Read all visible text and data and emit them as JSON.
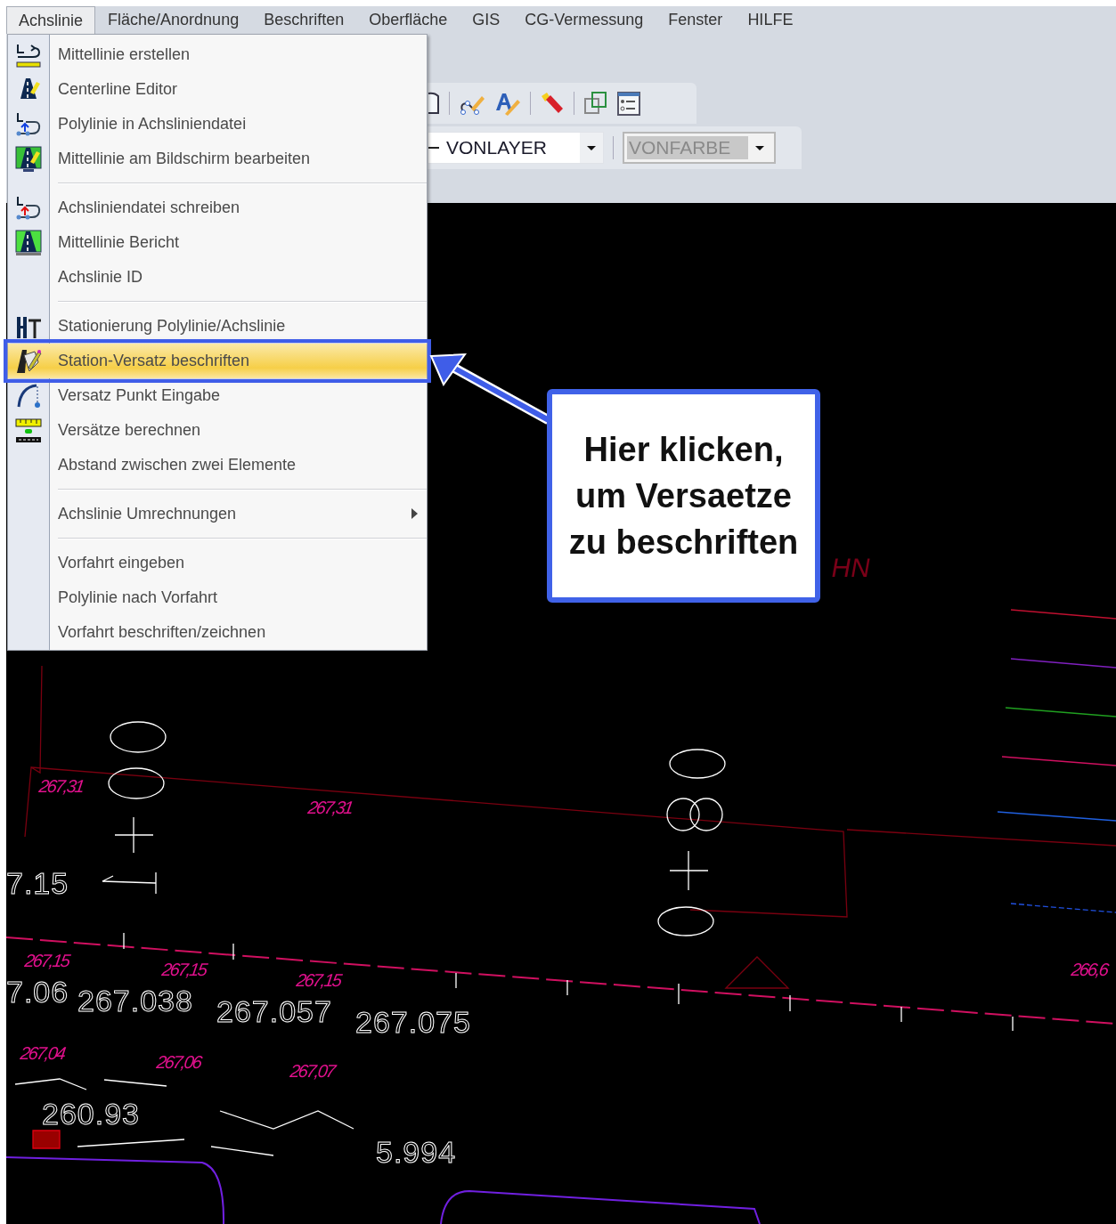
{
  "menu_bar": [
    {
      "label": "Achslinie",
      "selected": true
    },
    {
      "label": "Fläche/Anordnung",
      "selected": false
    },
    {
      "label": "Beschriften",
      "selected": false
    },
    {
      "label": "Oberfläche",
      "selected": false
    },
    {
      "label": "GIS",
      "selected": false
    },
    {
      "label": "CG-Vermessung",
      "selected": false
    },
    {
      "label": "Fenster",
      "selected": false
    },
    {
      "label": "HILFE",
      "selected": false
    }
  ],
  "menu": {
    "items": [
      {
        "kind": "item",
        "label": "Mittellinie erstellen",
        "selected": false
      },
      {
        "kind": "item",
        "label": "Centerline Editor",
        "selected": false
      },
      {
        "kind": "item",
        "label": "Polylinie in Achsliniendatei",
        "selected": false
      },
      {
        "kind": "item",
        "label": "Mittellinie am Bildschirm bearbeiten",
        "selected": false
      },
      {
        "kind": "separator"
      },
      {
        "kind": "item",
        "label": "Achsliniendatei schreiben",
        "selected": false
      },
      {
        "kind": "item",
        "label": "Mittellinie Bericht",
        "selected": false
      },
      {
        "kind": "item",
        "label": "Achslinie ID",
        "selected": false
      },
      {
        "kind": "separator"
      },
      {
        "kind": "item",
        "label": "Stationierung Polylinie/Achslinie",
        "selected": false
      },
      {
        "kind": "item",
        "label": "Station-Versatz beschriften",
        "selected": true
      },
      {
        "kind": "item",
        "label": "Versatz Punkt Eingabe",
        "selected": false
      },
      {
        "kind": "item",
        "label": "Versätze berechnen",
        "selected": false
      },
      {
        "kind": "item",
        "label": "Abstand zwischen zwei Elemente",
        "selected": false
      },
      {
        "kind": "separator"
      },
      {
        "kind": "submenu",
        "label": "Achslinie Umrechnungen",
        "selected": false
      },
      {
        "kind": "separator"
      },
      {
        "kind": "item",
        "label": "Vorfahrt eingeben",
        "selected": false
      },
      {
        "kind": "item",
        "label": "Polylinie nach Vorfahrt",
        "selected": false
      },
      {
        "kind": "item",
        "label": "Vorfahrt beschriften/zeichnen",
        "selected": false
      }
    ]
  },
  "toolbar": {
    "linetype": {
      "value": "VONLAYER",
      "disabled": false
    },
    "color": {
      "value": "VONFARBE",
      "disabled": true
    }
  },
  "callout": {
    "text": "Hier klicken, um Versaetze zu beschriften"
  },
  "drawing": {
    "labels": [
      {
        "text": "HN",
        "kind": "tag"
      },
      {
        "text": "267,31",
        "kind": "elevation"
      },
      {
        "text": "267,31",
        "kind": "elevation"
      },
      {
        "text": "7.15",
        "kind": "value"
      },
      {
        "text": "267,15",
        "kind": "elevation"
      },
      {
        "text": "267,15",
        "kind": "elevation"
      },
      {
        "text": "267,15",
        "kind": "elevation"
      },
      {
        "text": "266,6",
        "kind": "elevation"
      },
      {
        "text": "7.06",
        "kind": "value"
      },
      {
        "text": "267.038",
        "kind": "value"
      },
      {
        "text": "267.057",
        "kind": "value"
      },
      {
        "text": "267.075",
        "kind": "value"
      },
      {
        "text": "267,04",
        "kind": "elevation"
      },
      {
        "text": "267,06",
        "kind": "elevation"
      },
      {
        "text": "267,07",
        "kind": "elevation"
      },
      {
        "text": "260.93",
        "kind": "value"
      },
      {
        "text": "5.994",
        "kind": "value"
      }
    ]
  }
}
